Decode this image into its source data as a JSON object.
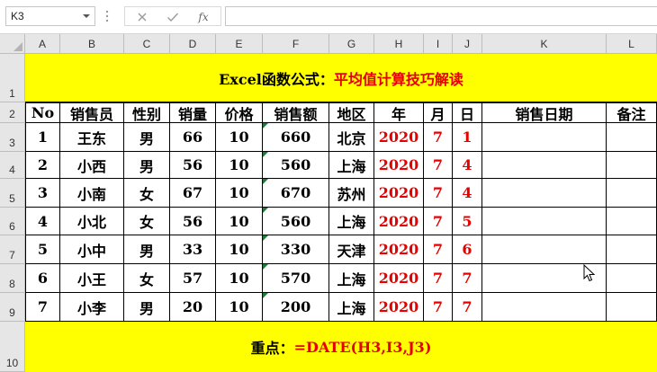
{
  "formula_bar": {
    "name_box": "K3",
    "cancel_icon": "close-icon",
    "enter_icon": "check-icon",
    "fx_label": "fx",
    "formula": ""
  },
  "columns": [
    "A",
    "B",
    "C",
    "D",
    "E",
    "F",
    "G",
    "H",
    "I",
    "J",
    "K",
    "L"
  ],
  "rows": [
    "1",
    "2",
    "3",
    "4",
    "5",
    "6",
    "7",
    "8",
    "9",
    "10"
  ],
  "title": {
    "prefix": "Excel函数公式：",
    "main": "平均值计算技巧解读"
  },
  "headers": [
    "No",
    "销售员",
    "性别",
    "销量",
    "价格",
    "销售额",
    "地区",
    "年",
    "月",
    "日",
    "销售日期",
    "备注"
  ],
  "table": [
    [
      "1",
      "王东",
      "男",
      "66",
      "10",
      "660",
      "北京",
      "2020",
      "7",
      "1",
      "",
      ""
    ],
    [
      "2",
      "小西",
      "男",
      "56",
      "10",
      "560",
      "上海",
      "2020",
      "7",
      "4",
      "",
      ""
    ],
    [
      "3",
      "小南",
      "女",
      "67",
      "10",
      "670",
      "苏州",
      "2020",
      "7",
      "4",
      "",
      ""
    ],
    [
      "4",
      "小北",
      "女",
      "56",
      "10",
      "560",
      "上海",
      "2020",
      "7",
      "5",
      "",
      ""
    ],
    [
      "5",
      "小中",
      "男",
      "33",
      "10",
      "330",
      "天津",
      "2020",
      "7",
      "6",
      "",
      ""
    ],
    [
      "6",
      "小王",
      "女",
      "57",
      "10",
      "570",
      "上海",
      "2020",
      "7",
      "7",
      "",
      ""
    ],
    [
      "7",
      "小李",
      "男",
      "20",
      "10",
      "200",
      "上海",
      "2020",
      "7",
      "7",
      "",
      ""
    ]
  ],
  "footer": {
    "label": "重点：",
    "formula": "=DATE(H3,I3,J3)"
  },
  "colors": {
    "banner": "#ffff00",
    "accent_red": "#e60000",
    "header_gray": "#e6e6e6"
  }
}
